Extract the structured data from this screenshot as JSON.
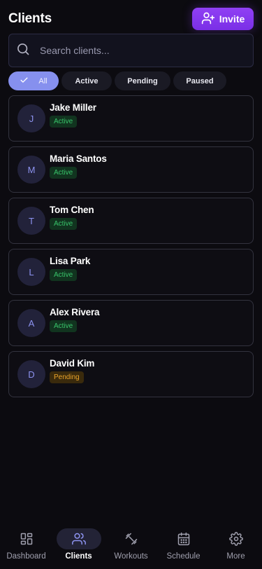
{
  "header": {
    "title": "Clients",
    "invite_label": "Invite"
  },
  "search": {
    "placeholder": "Search clients..."
  },
  "filters": [
    {
      "label": "All",
      "selected": true
    },
    {
      "label": "Active"
    },
    {
      "label": "Pending"
    },
    {
      "label": "Paused"
    }
  ],
  "clients": [
    {
      "initial": "J",
      "name": "Jake Miller",
      "status": "Active"
    },
    {
      "initial": "M",
      "name": "Maria Santos",
      "status": "Active"
    },
    {
      "initial": "T",
      "name": "Tom Chen",
      "status": "Active"
    },
    {
      "initial": "L",
      "name": "Lisa Park",
      "status": "Active"
    },
    {
      "initial": "A",
      "name": "Alex Rivera",
      "status": "Active"
    },
    {
      "initial": "D",
      "name": "David Kim",
      "status": "Pending"
    }
  ],
  "nav": [
    {
      "label": "Dashboard",
      "icon": "grid-icon"
    },
    {
      "label": "Clients",
      "icon": "users-icon",
      "selected": true
    },
    {
      "label": "Workouts",
      "icon": "dumbbell-icon"
    },
    {
      "label": "Schedule",
      "icon": "calendar-icon"
    },
    {
      "label": "More",
      "icon": "gear-icon"
    }
  ],
  "colors": {
    "background": "#0c0b10",
    "accent": "#8a3cf0",
    "chip_selected": "#8690ee",
    "status_active": "#38c46a",
    "status_pending": "#e8a22a"
  }
}
